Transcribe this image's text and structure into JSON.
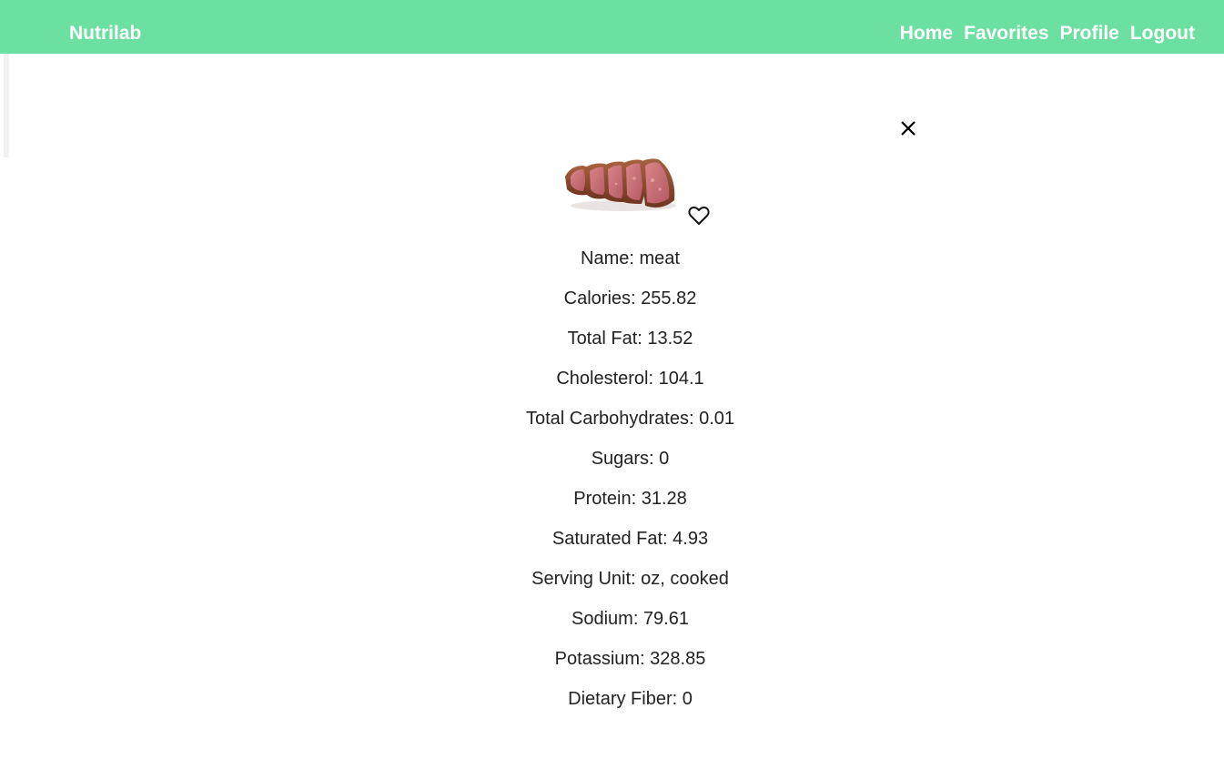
{
  "nav": {
    "brand": "Nutrilab",
    "links": [
      "Home",
      "Favorites",
      "Profile",
      "Logout"
    ]
  },
  "colors": {
    "navbar": "#6ce0a0",
    "text": "#222222"
  },
  "icons": {
    "close": "close-icon",
    "favorite": "heart-outline-icon"
  },
  "food": {
    "image_alt": "sliced cooked meat",
    "details": [
      "Name: meat",
      "Calories: 255.82",
      "Total Fat: 13.52",
      "Cholesterol: 104.1",
      "Total Carbohydrates: 0.01",
      "Sugars: 0",
      "Protein: 31.28",
      "Saturated Fat: 4.93",
      "Serving Unit: oz, cooked",
      "Sodium: 79.61",
      "Potassium: 328.85",
      "Dietary Fiber: 0"
    ]
  }
}
